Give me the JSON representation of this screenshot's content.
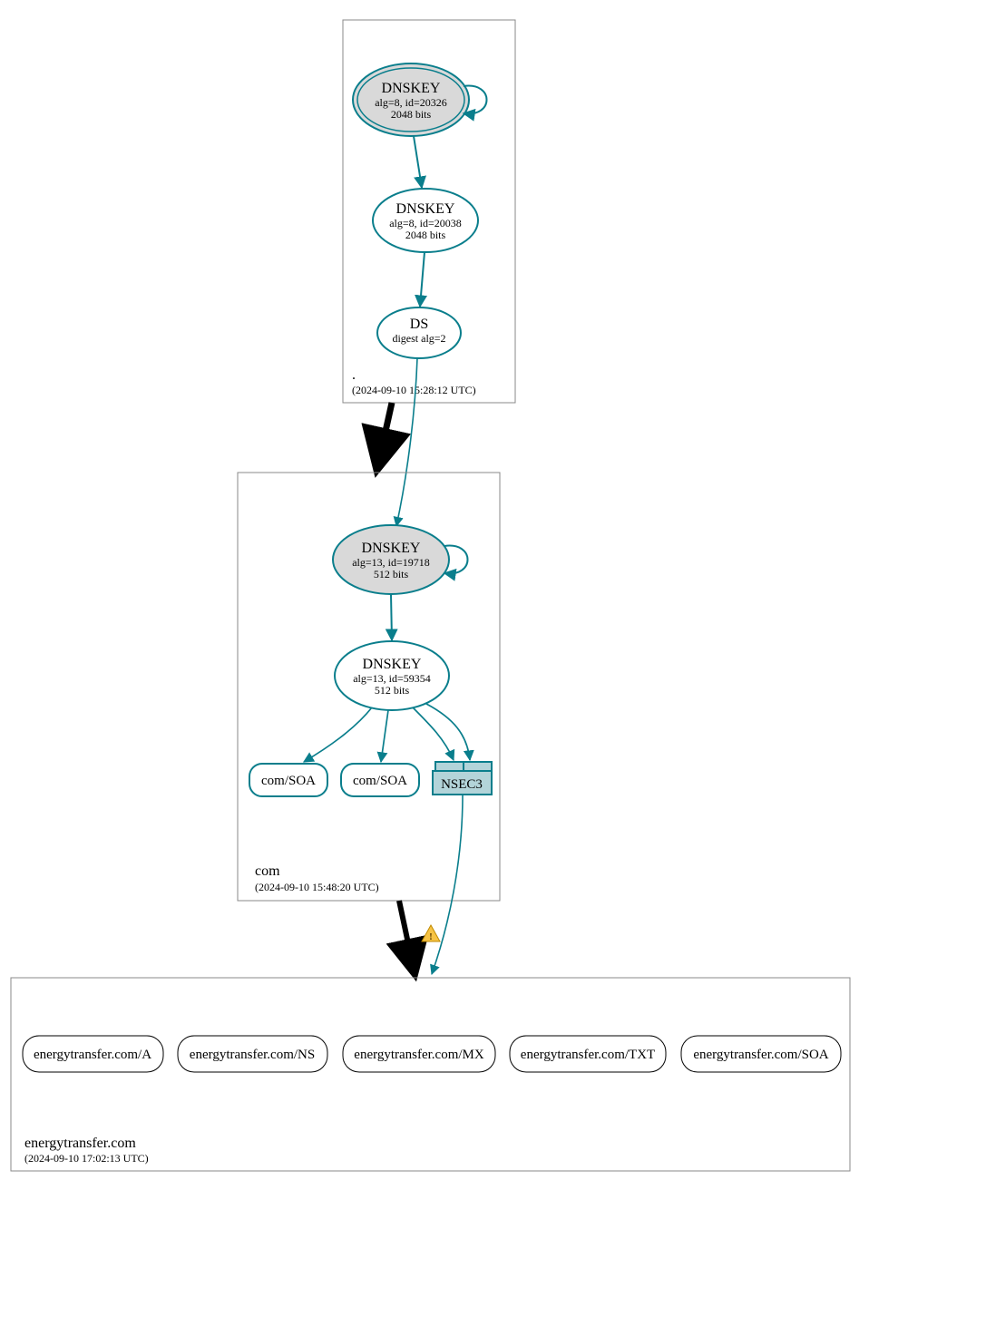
{
  "colors": {
    "teal": "#0a7e8c",
    "grayfill": "#d9d9d9",
    "lightteal": "#b3d4d9",
    "black": "#000000"
  },
  "zones": {
    "root": {
      "name": ".",
      "timestamp": "(2024-09-10 15:28:12 UTC)",
      "nodes": {
        "ksk": {
          "title": "DNSKEY",
          "line2": "alg=8, id=20326",
          "line3": "2048 bits"
        },
        "zsk": {
          "title": "DNSKEY",
          "line2": "alg=8, id=20038",
          "line3": "2048 bits"
        },
        "ds": {
          "title": "DS",
          "line2": "digest alg=2"
        }
      }
    },
    "com": {
      "name": "com",
      "timestamp": "(2024-09-10 15:48:20 UTC)",
      "nodes": {
        "ksk": {
          "title": "DNSKEY",
          "line2": "alg=13, id=19718",
          "line3": "512 bits"
        },
        "zsk": {
          "title": "DNSKEY",
          "line2": "alg=13, id=59354",
          "line3": "512 bits"
        },
        "soa1": {
          "label": "com/SOA"
        },
        "soa2": {
          "label": "com/SOA"
        },
        "nsec3": {
          "label": "NSEC3"
        }
      }
    },
    "target": {
      "name": "energytransfer.com",
      "timestamp": "(2024-09-10 17:02:13 UTC)",
      "records": {
        "a": "energytransfer.com/A",
        "ns": "energytransfer.com/NS",
        "mx": "energytransfer.com/MX",
        "txt": "energytransfer.com/TXT",
        "soa": "energytransfer.com/SOA"
      }
    }
  },
  "warning_glyph": "⚠"
}
